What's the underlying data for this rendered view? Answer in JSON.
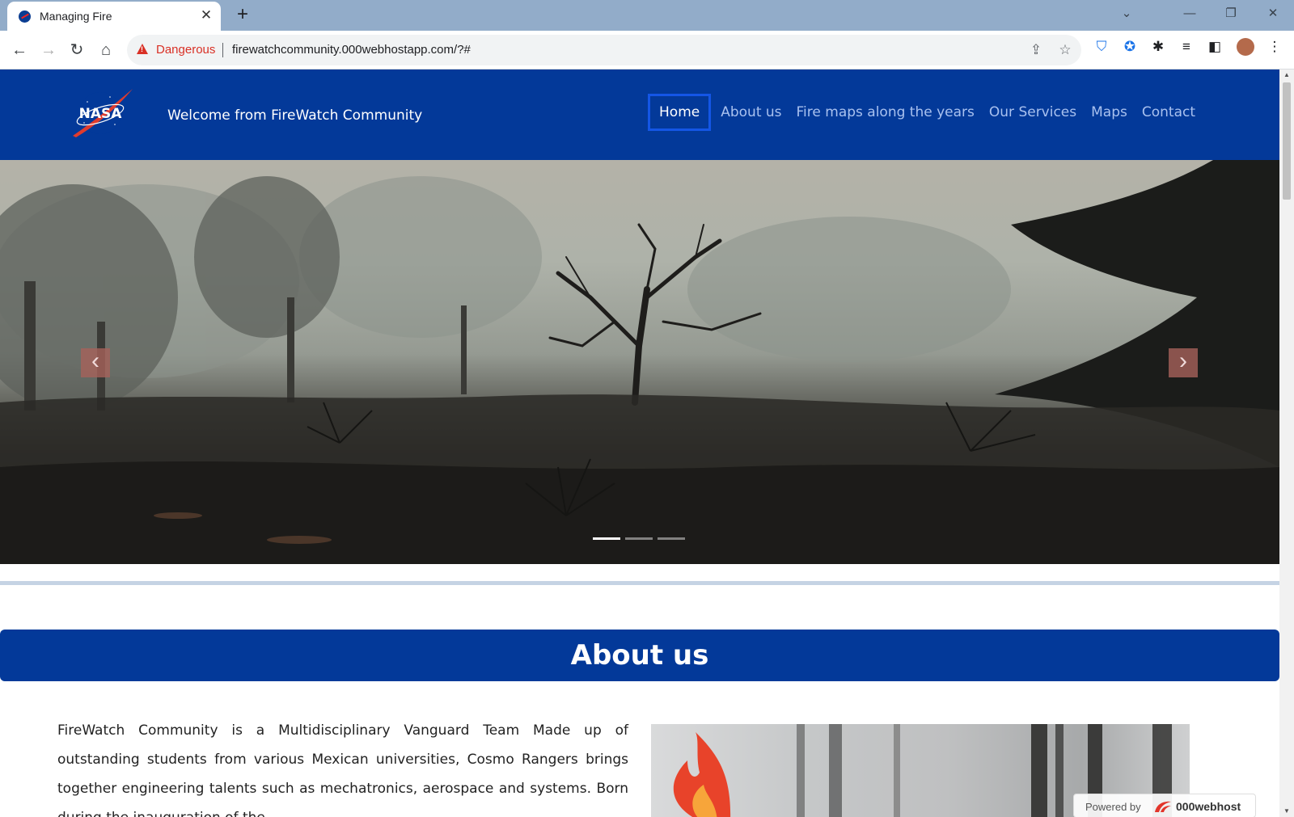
{
  "browser": {
    "tab_title": "Managing Fire",
    "tab_close": "✕",
    "new_tab": "+",
    "security_label": "Dangerous",
    "url": "firewatchcommunity.000webhostapp.com/?#"
  },
  "site": {
    "header_title": "Welcome from FireWatch Community",
    "logo_text": "NASA",
    "nav": [
      "Home",
      "About us",
      "Fire maps along the years",
      "Our Services",
      "Maps",
      "Contact"
    ],
    "active_nav": "Home",
    "colors": {
      "header": "#033999",
      "active_border": "#1456e6",
      "nav_link": "#a9c1ef"
    }
  },
  "carousel": {
    "prev": "‹",
    "next": "›",
    "slide_count": 3,
    "active_slide": 1
  },
  "about": {
    "title": "About us",
    "paragraph": "FireWatch Community is a Multidisciplinary Vanguard Team Made up of outstanding students from various Mexican universities, Cosmo Rangers brings together engineering talents such as mechatronics, aerospace and systems. Born during the inauguration of the"
  },
  "badge": {
    "powered_by": "Powered by",
    "host": "000webhost"
  },
  "icons": {
    "back": "←",
    "forward": "→",
    "reload": "↻",
    "home": "⌂",
    "share": "⇪",
    "bookmark": "☆",
    "extensions": "✱",
    "menu": "⋮",
    "minimize": "—",
    "restore": "❐",
    "close": "✕",
    "tab_list": "⌄"
  }
}
